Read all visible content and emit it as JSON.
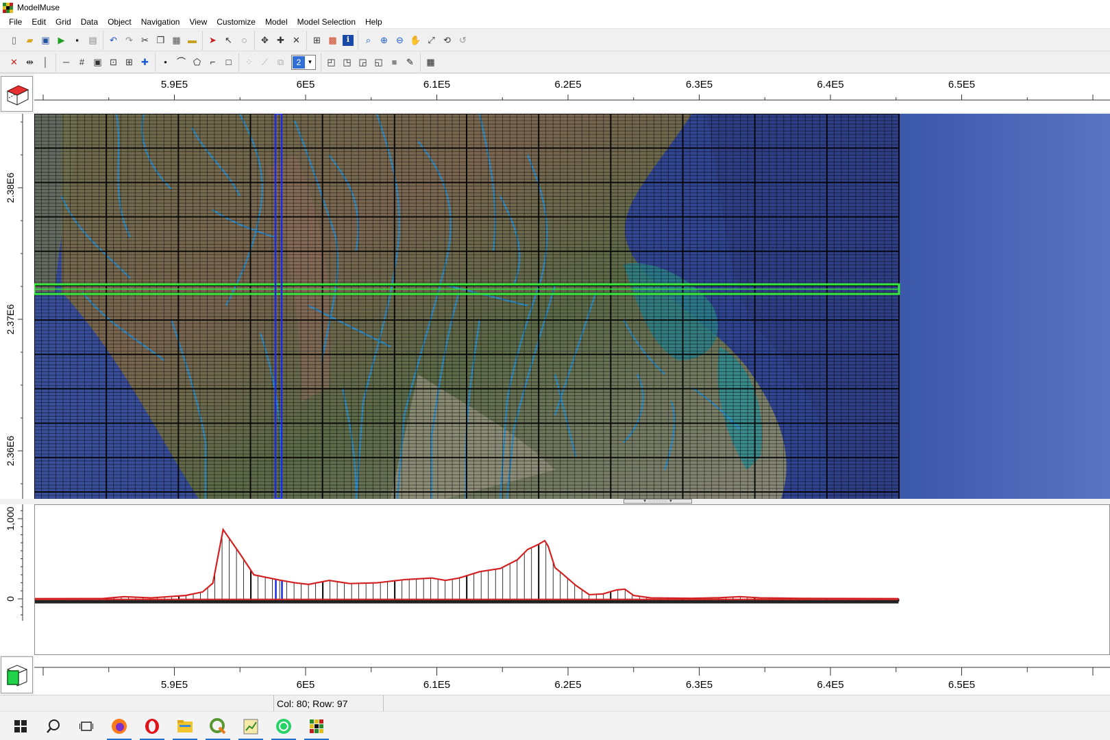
{
  "window": {
    "title": "ModelMuse"
  },
  "menu": [
    "File",
    "Edit",
    "Grid",
    "Data",
    "Object",
    "Navigation",
    "View",
    "Customize",
    "Model",
    "Model Selection",
    "Help"
  ],
  "toolbar1": {
    "groups": [
      [
        "new-file-icon",
        "open-folder-icon",
        "save-icon",
        "run-model-icon",
        "export-icon",
        "print-preview-icon"
      ],
      [
        "undo-icon",
        "redo-icon",
        "cut-icon",
        "copy-icon",
        "paste-icon",
        "ruler-icon"
      ],
      [
        "select-arrow-icon",
        "select-vertex-icon",
        "lasso-icon"
      ],
      [
        "move-vertex-icon",
        "add-vertex-icon",
        "delete-vertex-icon"
      ],
      [
        "object-tree-icon",
        "color-grid-icon",
        "info-icon"
      ],
      [
        "zoom-icon",
        "zoom-in-icon",
        "zoom-out-icon",
        "pan-icon",
        "zoom-extents-icon",
        "rotate-icon",
        "restore-icon"
      ]
    ]
  },
  "toolbar2": {
    "groups": [
      [
        "delete-column-icon",
        "split-column-icon",
        "vertical-line-icon"
      ],
      [
        "horizontal-line-icon",
        "grid-icon",
        "grid-inner-icon",
        "grid-smooth-icon",
        "grid-center-icon",
        "add-point-icon"
      ],
      [
        "point-object-icon",
        "polyline-object-icon",
        "polygon-object-icon",
        "straight-line-object-icon",
        "rectangle-object-icon"
      ],
      [
        "dots-icon",
        "lines-icon",
        "layer-stack-icon"
      ],
      [
        "box-front-icon",
        "box-side-icon",
        "box-top-icon",
        "box-3d-icon",
        "shaded-box-icon",
        "pencil-box-icon"
      ],
      [
        "table-icon"
      ]
    ],
    "layer_select_value": "2"
  },
  "top_view": {
    "x_ticks": [
      {
        "value": 590000,
        "label": "5.9E5"
      },
      {
        "value": 600000,
        "label": "6E5"
      },
      {
        "value": 610000,
        "label": "6.1E5"
      },
      {
        "value": 620000,
        "label": "6.2E5"
      },
      {
        "value": 630000,
        "label": "6.3E5"
      },
      {
        "value": 640000,
        "label": "6.4E5"
      },
      {
        "value": 650000,
        "label": "6.5E5"
      }
    ],
    "y_ticks": [
      {
        "value": 2380000,
        "label": "2.38E6"
      },
      {
        "value": 2370000,
        "label": "2.37E6"
      },
      {
        "value": 2360000,
        "label": "2.36E6"
      }
    ],
    "grid_columns": 120,
    "grid_rows": 112,
    "selected_column": 80,
    "selected_row": 97
  },
  "front_view": {
    "y_ticks": [
      {
        "value": 1000,
        "label": "1,000"
      },
      {
        "value": 0,
        "label": "0"
      }
    ]
  },
  "status": {
    "left": "",
    "cell_info": "Col: 80; Row: 97",
    "right": ""
  },
  "taskbar": [
    {
      "icon": "windows-start-icon",
      "running": false
    },
    {
      "icon": "search-icon",
      "running": false
    },
    {
      "icon": "task-view-icon",
      "running": false
    },
    {
      "icon": "firefox-icon",
      "running": true
    },
    {
      "icon": "opera-icon",
      "running": true
    },
    {
      "icon": "file-explorer-icon",
      "running": true
    },
    {
      "icon": "qgis-icon",
      "running": true
    },
    {
      "icon": "notepad-chart-icon",
      "running": true
    },
    {
      "icon": "whatsapp-icon",
      "running": true
    },
    {
      "icon": "modelmuse-icon",
      "running": true
    }
  ]
}
